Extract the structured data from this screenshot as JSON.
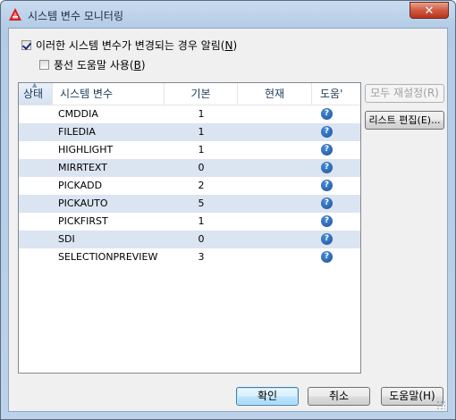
{
  "window": {
    "title": "시스템 변수 모니터링"
  },
  "options": {
    "notify_label": "이러한 시스템 변수가 변경되는 경우 알림",
    "notify_key": "N",
    "notify_checked": true,
    "balloon_label": "풍선 도움말 사용",
    "balloon_key": "B",
    "balloon_checked": false
  },
  "list": {
    "headers": {
      "status": "상태",
      "name": "시스템 변수",
      "default": "기본",
      "current": "현재",
      "help": "도움'"
    },
    "rows": [
      {
        "name": "CMDDIA",
        "default": "1",
        "current": ""
      },
      {
        "name": "FILEDIA",
        "default": "1",
        "current": ""
      },
      {
        "name": "HIGHLIGHT",
        "default": "1",
        "current": ""
      },
      {
        "name": "MIRRTEXT",
        "default": "0",
        "current": ""
      },
      {
        "name": "PICKADD",
        "default": "2",
        "current": ""
      },
      {
        "name": "PICKAUTO",
        "default": "5",
        "current": ""
      },
      {
        "name": "PICKFIRST",
        "default": "1",
        "current": ""
      },
      {
        "name": "SDI",
        "default": "0",
        "current": ""
      },
      {
        "name": "SELECTIONPREVIEW",
        "default": "3",
        "current": ""
      }
    ]
  },
  "side_buttons": {
    "reset_all": "모두 재설정(R)",
    "edit_list": "리스트 편집(E)..."
  },
  "footer": {
    "ok": "확인",
    "cancel": "취소",
    "help": "도움말(H)"
  },
  "colors": {
    "help_icon": "#1b4f9c",
    "alt_row": "#dbe4f1",
    "close_button": "#c84a30"
  },
  "icons": {
    "app": "autocad-a-icon",
    "help": "help-question-icon",
    "close": "close-icon"
  }
}
